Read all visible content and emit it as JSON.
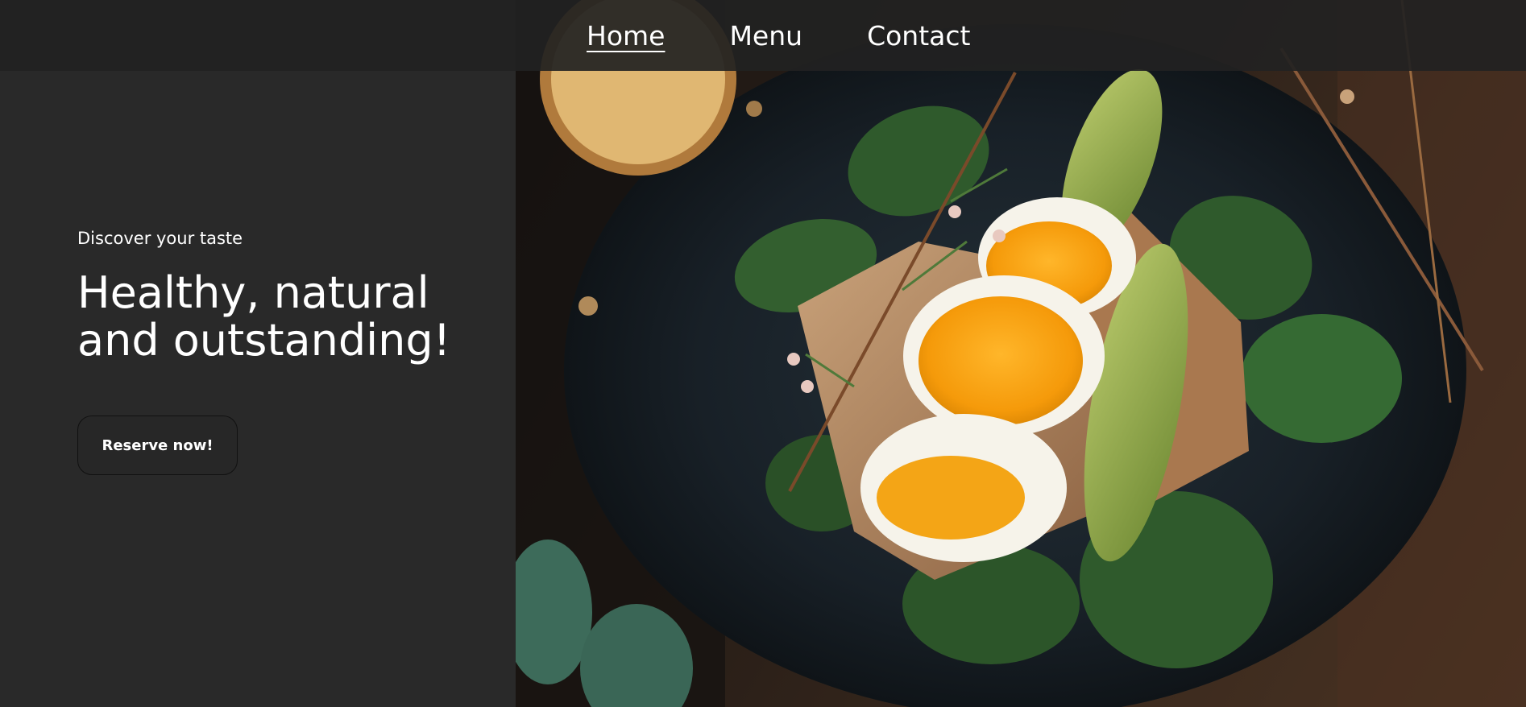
{
  "nav": {
    "items": [
      {
        "label": "Home",
        "active": true
      },
      {
        "label": "Menu",
        "active": false
      },
      {
        "label": "Contact",
        "active": false
      }
    ]
  },
  "hero": {
    "tagline": "Discover your taste",
    "headline_line1": "Healthy, natural",
    "headline_line2": "and outstanding!",
    "cta_label": "Reserve now!"
  },
  "colors": {
    "left_panel_bg": "#292929",
    "navbar_bg": "#222222",
    "text": "#ffffff"
  }
}
